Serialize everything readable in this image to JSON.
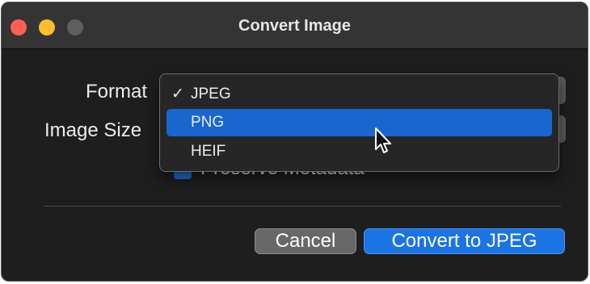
{
  "window": {
    "title": "Convert Image",
    "traffic_lights": {
      "close_color": "#fe5f57",
      "minimize_color": "#febc2e",
      "zoom_color": "#5f5f5f"
    }
  },
  "form": {
    "format_label": "Format",
    "image_size_label": "Image Size",
    "preserve_metadata_label": "Preserve Metadata",
    "preserve_metadata_checked": true
  },
  "format_menu": {
    "items": [
      {
        "label": "JPEG",
        "checked": true,
        "highlighted": false
      },
      {
        "label": "PNG",
        "checked": false,
        "highlighted": true
      },
      {
        "label": "HEIF",
        "checked": false,
        "highlighted": false
      }
    ],
    "check_glyph": "✓"
  },
  "buttons": {
    "cancel_label": "Cancel",
    "primary_label": "Convert to JPEG"
  },
  "colors": {
    "accent": "#1a74e3",
    "menu_highlight": "#1966cf"
  },
  "cursor": {
    "icon": "arrow-cursor-icon"
  }
}
